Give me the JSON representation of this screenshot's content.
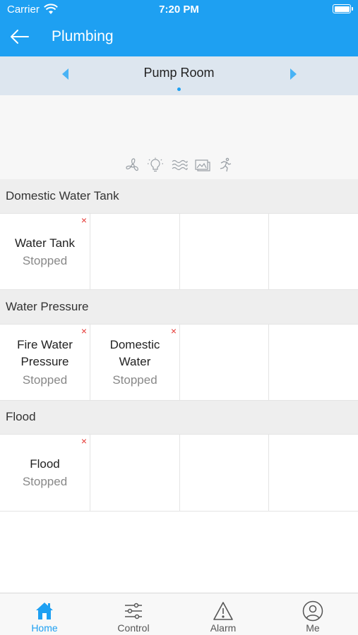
{
  "status_bar": {
    "carrier": "Carrier",
    "time": "7:20 PM"
  },
  "header": {
    "title": "Plumbing",
    "back_icon": "arrow-left-icon"
  },
  "room_nav": {
    "room_name": "Pump Room",
    "pages": 1,
    "current_page": 1
  },
  "category_icons": [
    "fan-icon",
    "light-bulb-icon",
    "water-waves-icon",
    "image-gallery-icon",
    "running-person-icon"
  ],
  "sections": [
    {
      "title": "Domestic Water Tank",
      "devices": [
        {
          "name": "Water Tank",
          "status": "Stopped",
          "alert": "×"
        }
      ]
    },
    {
      "title": "Water Pressure",
      "devices": [
        {
          "name": "Fire Water Pressure",
          "name_lines": [
            "Fire Water",
            "Pressure"
          ],
          "status": "Stopped",
          "alert": "×"
        },
        {
          "name": "Domestic Water",
          "name_lines": [
            "Domestic",
            "Water"
          ],
          "status": "Stopped",
          "alert": "×"
        }
      ]
    },
    {
      "title": "Flood",
      "devices": [
        {
          "name": "Flood",
          "status": "Stopped",
          "alert": "×"
        }
      ]
    }
  ],
  "tabbar": {
    "active": "Home",
    "items": [
      {
        "label": "Home",
        "icon": "home-icon"
      },
      {
        "label": "Control",
        "icon": "sliders-icon"
      },
      {
        "label": "Alarm",
        "icon": "warning-icon"
      },
      {
        "label": "Me",
        "icon": "user-icon"
      }
    ]
  },
  "colors": {
    "accent": "#1ea0f2",
    "alert": "#e53935",
    "section_bg": "#eeeeee",
    "nav_bg": "#dde6ef"
  }
}
